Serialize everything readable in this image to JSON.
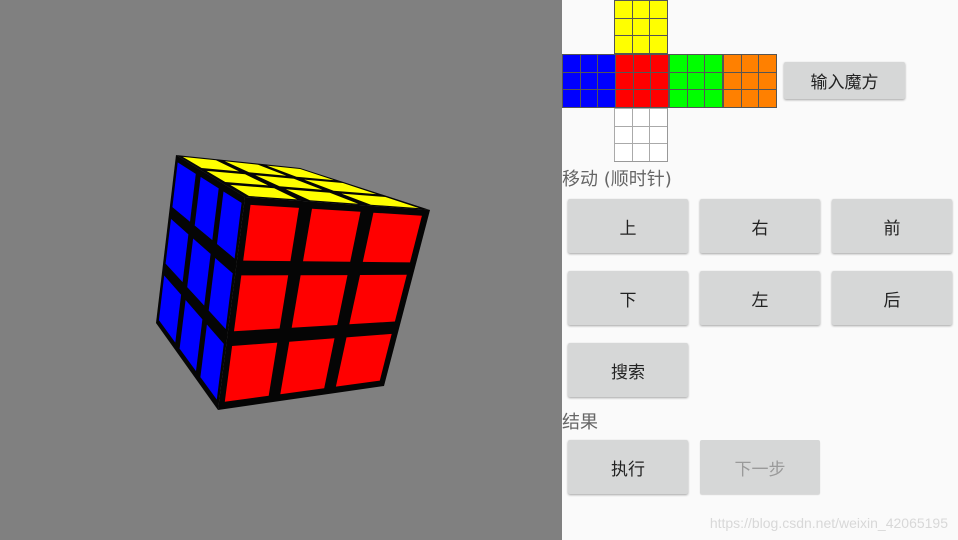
{
  "colors": {
    "viewport_bg": "#808080",
    "yellow": "#ffff00",
    "blue": "#0000ff",
    "red": "#ff0000",
    "green": "#00ff00",
    "orange": "#ff8000",
    "white": "#ffffff"
  },
  "cube_net": {
    "faces": [
      {
        "name": "up",
        "color": "yellow"
      },
      {
        "name": "left",
        "color": "blue"
      },
      {
        "name": "front",
        "color": "red"
      },
      {
        "name": "right",
        "color": "green"
      },
      {
        "name": "back",
        "color": "orange"
      },
      {
        "name": "down",
        "color": "white"
      }
    ]
  },
  "input_button": {
    "label": "输入魔方"
  },
  "move_section": {
    "label": "移动 (顺时针)",
    "buttons": [
      {
        "label": "上"
      },
      {
        "label": "右"
      },
      {
        "label": "前"
      },
      {
        "label": "下"
      },
      {
        "label": "左"
      },
      {
        "label": "后"
      }
    ]
  },
  "search_button": {
    "label": "搜索"
  },
  "result_section": {
    "label": "结果"
  },
  "execute_button": {
    "label": "执行"
  },
  "next_step_button": {
    "label": "下一步",
    "enabled": false
  },
  "watermark": "https://blog.csdn.net/weixin_42065195"
}
